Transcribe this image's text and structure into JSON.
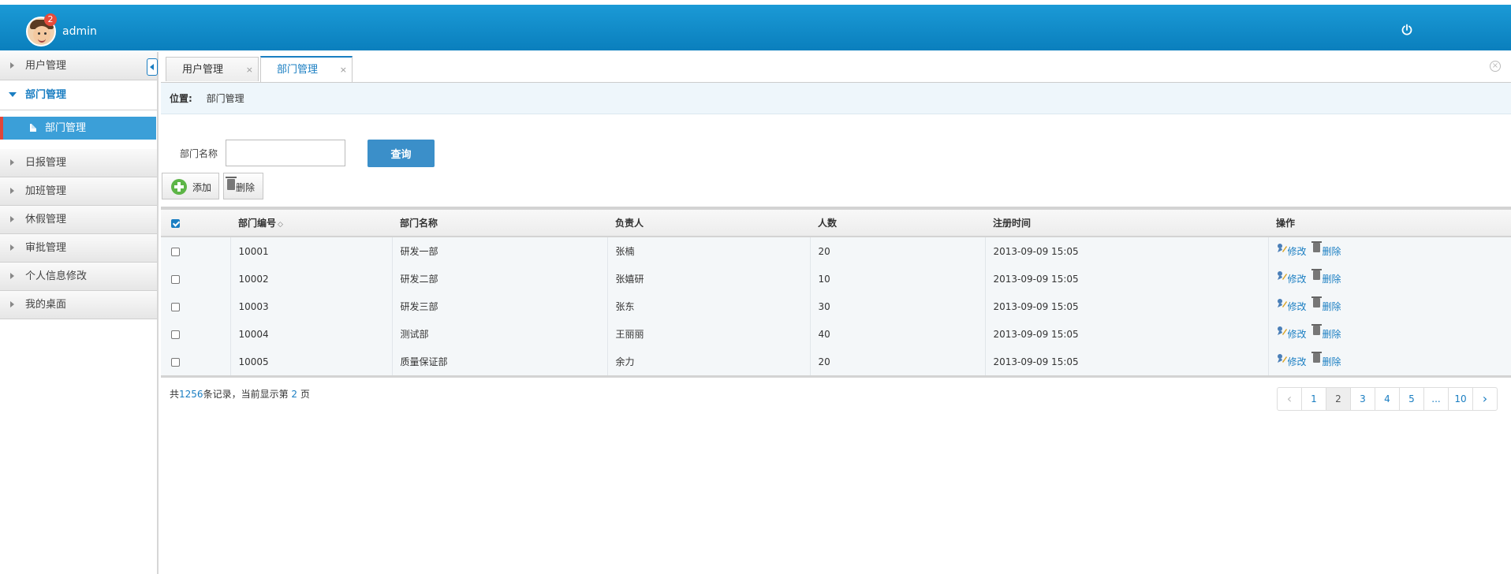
{
  "header": {
    "username": "admin",
    "notification_count": "2",
    "avatar_icon": "user-avatar-icon",
    "power_icon": "power-icon",
    "colors": {
      "bar_top": "#1b9ad6",
      "bar_bottom": "#0a7fbd",
      "badge": "#e64c3c"
    }
  },
  "sidebar": {
    "items": [
      {
        "label": "用户管理"
      },
      {
        "label": "部门管理"
      },
      {
        "label": "日报管理"
      },
      {
        "label": "加班管理"
      },
      {
        "label": "休假管理"
      },
      {
        "label": "审批管理"
      },
      {
        "label": "个人信息修改"
      },
      {
        "label": "我的桌面"
      }
    ],
    "subitem": {
      "label": "部门管理"
    },
    "colors": {
      "active_bg": "#3b9fd8",
      "active_marker": "#e0463a"
    }
  },
  "tabs": [
    {
      "label": "用户管理",
      "close": "×"
    },
    {
      "label": "部门管理",
      "close": "×"
    }
  ],
  "close_all": "×",
  "breadcrumb": {
    "label": "位置:",
    "value": "部门管理"
  },
  "search": {
    "label": "部门名称",
    "value": "",
    "placeholder": "",
    "button": "查询"
  },
  "toolbar": {
    "add": "添加",
    "delete": "删除"
  },
  "table": {
    "headers": {
      "id": "部门编号",
      "sort_glyph": "◇",
      "name": "部门名称",
      "leader": "负责人",
      "count": "人数",
      "registered": "注册时间",
      "action": "操作"
    },
    "rows": [
      {
        "id": "10001",
        "name": "研发一部",
        "leader": "张楠",
        "count": "20",
        "registered": "2013-09-09 15:05",
        "edit": "修改",
        "delete": "删除"
      },
      {
        "id": "10002",
        "name": "研发二部",
        "leader": "张嬉研",
        "count": "10",
        "registered": "2013-09-09 15:05",
        "edit": "修改",
        "delete": "删除"
      },
      {
        "id": "10003",
        "name": "研发三部",
        "leader": "张东",
        "count": "30",
        "registered": "2013-09-09 15:05",
        "edit": "修改",
        "delete": "删除"
      },
      {
        "id": "10004",
        "name": "测试部",
        "leader": "王丽丽",
        "count": "40",
        "registered": "2013-09-09 15:05",
        "edit": "修改",
        "delete": "删除"
      },
      {
        "id": "10005",
        "name": "质量保证部",
        "leader": "余力",
        "count": "20",
        "registered": "2013-09-09 15:05",
        "edit": "修改",
        "delete": "删除"
      }
    ]
  },
  "records": {
    "prefix": "共",
    "total": "1256",
    "middle": "条记录，当前显示第",
    "current": "2",
    "suffix": "页"
  },
  "pagination": {
    "prev": "‹",
    "pages": [
      "1",
      "2",
      "3",
      "4",
      "5",
      "...",
      "10"
    ],
    "current_page": "2",
    "next": "›"
  }
}
